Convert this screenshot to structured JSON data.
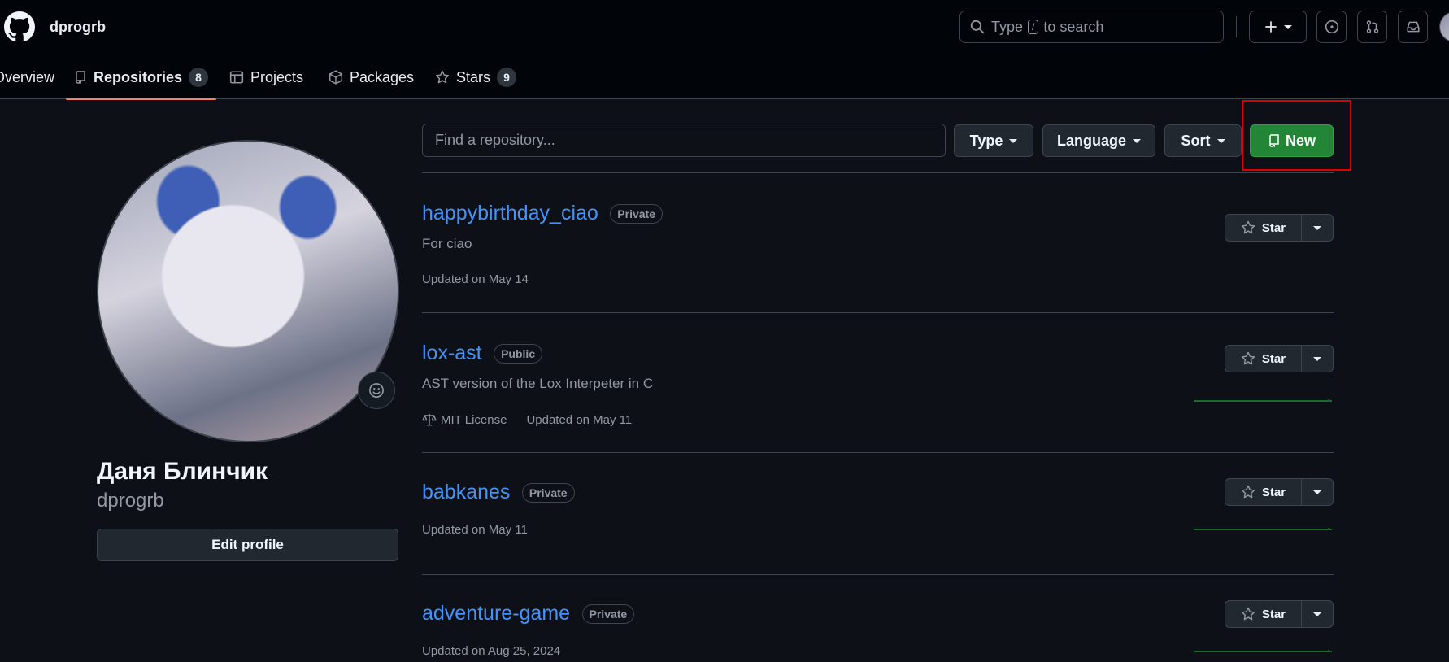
{
  "header": {
    "username": "dprogrb",
    "search_pre": "Type",
    "search_key": "/",
    "search_post": "to search"
  },
  "tabs": [
    {
      "label": "Overview"
    },
    {
      "label": "Repositories",
      "count": "8"
    },
    {
      "label": "Projects"
    },
    {
      "label": "Packages"
    },
    {
      "label": "Stars",
      "count": "9"
    }
  ],
  "profile": {
    "full_name": "Даня Блинчик",
    "login": "dprogrb",
    "edit_label": "Edit profile"
  },
  "toolbar": {
    "find_placeholder": "Find a repository...",
    "type_label": "Type",
    "language_label": "Language",
    "sort_label": "Sort",
    "new_label": "New"
  },
  "repos": [
    {
      "name": "happybirthday_ciao",
      "visibility": "Private",
      "description": "For ciao",
      "license": "",
      "updated": "Updated on May 14",
      "star_label": "Star"
    },
    {
      "name": "lox-ast",
      "visibility": "Public",
      "description": "AST version of the Lox Interpeter in C",
      "license": "MIT License",
      "updated": "Updated on May 11",
      "star_label": "Star"
    },
    {
      "name": "babkanes",
      "visibility": "Private",
      "description": "",
      "license": "",
      "updated": "Updated on May 11",
      "star_label": "Star"
    },
    {
      "name": "adventure-game",
      "visibility": "Private",
      "description": "",
      "license": "",
      "updated": "Updated on Aug 25, 2024",
      "star_label": "Star"
    }
  ],
  "colors": {
    "background": "#0d1117",
    "link": "#4493f8",
    "primary_button": "#238636",
    "active_tab_underline": "#f78166",
    "highlight": "#e00000"
  }
}
